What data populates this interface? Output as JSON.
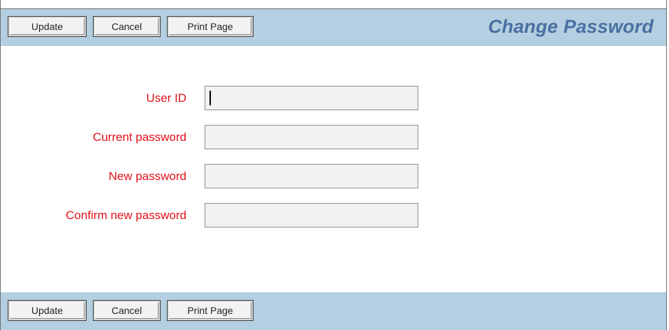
{
  "toolbar": {
    "update_label": "Update",
    "cancel_label": "Cancel",
    "print_label": "Print Page"
  },
  "page": {
    "title": "Change Password"
  },
  "form": {
    "user_id": {
      "label": "User ID",
      "value": ""
    },
    "current_password": {
      "label": "Current password",
      "value": ""
    },
    "new_password": {
      "label": "New password",
      "value": ""
    },
    "confirm_password": {
      "label": "Confirm new password",
      "value": ""
    }
  },
  "colors": {
    "toolbar_bg": "#b3cfe1",
    "title": "#4a6fa1",
    "label": "#e0111b",
    "input_bg": "#f2f2f2"
  }
}
